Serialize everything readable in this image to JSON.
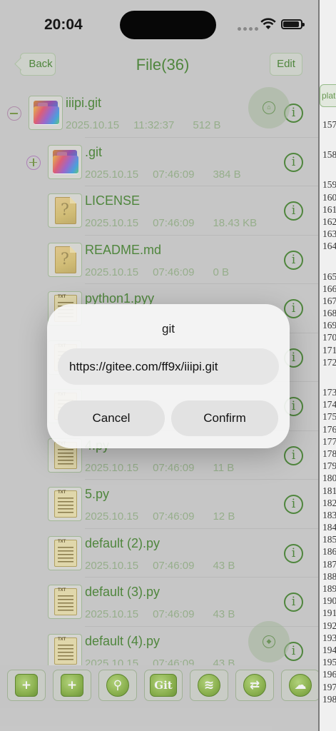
{
  "status": {
    "time": "20:04"
  },
  "nav": {
    "back": "Back",
    "title": "File(36)",
    "edit": "Edit"
  },
  "files": [
    {
      "name": "iiipi.git",
      "date": "2025.10.15",
      "time": "11:32:37",
      "size": "512 B",
      "type": "folder",
      "toggle": "minus"
    },
    {
      "name": ".git",
      "date": "2025.10.15",
      "time": "07:46:09",
      "size": "384 B",
      "type": "folder",
      "toggle": "plus"
    },
    {
      "name": "LICENSE",
      "date": "2025.10.15",
      "time": "07:46:09",
      "size": "18.43 KB",
      "type": "doc"
    },
    {
      "name": "README.md",
      "date": "2025.10.15",
      "time": "07:46:09",
      "size": "0 B",
      "type": "doc"
    },
    {
      "name": "python1.pyy",
      "date": "",
      "time": "",
      "size": "",
      "type": "txt"
    },
    {
      "name": "",
      "date": "",
      "time": "",
      "size": "",
      "type": "txt"
    },
    {
      "name": "",
      "date": "",
      "time": "",
      "size": "",
      "type": "txt"
    },
    {
      "name": "4.py",
      "date": "2025.10.15",
      "time": "07:46:09",
      "size": "11 B",
      "type": "txt"
    },
    {
      "name": "5.py",
      "date": "2025.10.15",
      "time": "07:46:09",
      "size": "12 B",
      "type": "txt"
    },
    {
      "name": "default (2).py",
      "date": "2025.10.15",
      "time": "07:46:09",
      "size": "43 B",
      "type": "txt"
    },
    {
      "name": "default (3).py",
      "date": "2025.10.15",
      "time": "07:46:09",
      "size": "43 B",
      "type": "txt"
    },
    {
      "name": "default (4).py",
      "date": "2025.10.15",
      "time": "07:46:09",
      "size": "43 B",
      "type": "txt"
    }
  ],
  "icons": {
    "info": "i",
    "txt_label": "TXT"
  },
  "toolbar": {
    "items": [
      {
        "name": "new-folder",
        "glyph": "+"
      },
      {
        "name": "new-file",
        "glyph": "+"
      },
      {
        "name": "search",
        "glyph": "⚲"
      },
      {
        "name": "git",
        "glyph": "Git"
      },
      {
        "name": "wifi",
        "glyph": "≋"
      },
      {
        "name": "transfer",
        "glyph": "⇄"
      },
      {
        "name": "cloud",
        "glyph": "☁"
      }
    ]
  },
  "dialog": {
    "title": "git",
    "url_value": "https://gitee.com/ff9x/iiipi.git",
    "cancel": "Cancel",
    "confirm": "Confirm"
  },
  "peek": {
    "tab": "plate",
    "lines": [
      "157",
      "",
      "158",
      "",
      "159",
      "160",
      "161",
      "162",
      "163",
      "164",
      "",
      "165",
      "166",
      "167",
      "168",
      "169",
      "170",
      "171",
      "172",
      "",
      "173",
      "174",
      "175",
      "176",
      "177",
      "178",
      "179",
      "180",
      "181",
      "182",
      "183",
      "184",
      "185",
      "186",
      "187",
      "188",
      "189",
      "190",
      "191",
      "192",
      "193",
      "194",
      "195",
      "196",
      "197",
      "198"
    ]
  }
}
